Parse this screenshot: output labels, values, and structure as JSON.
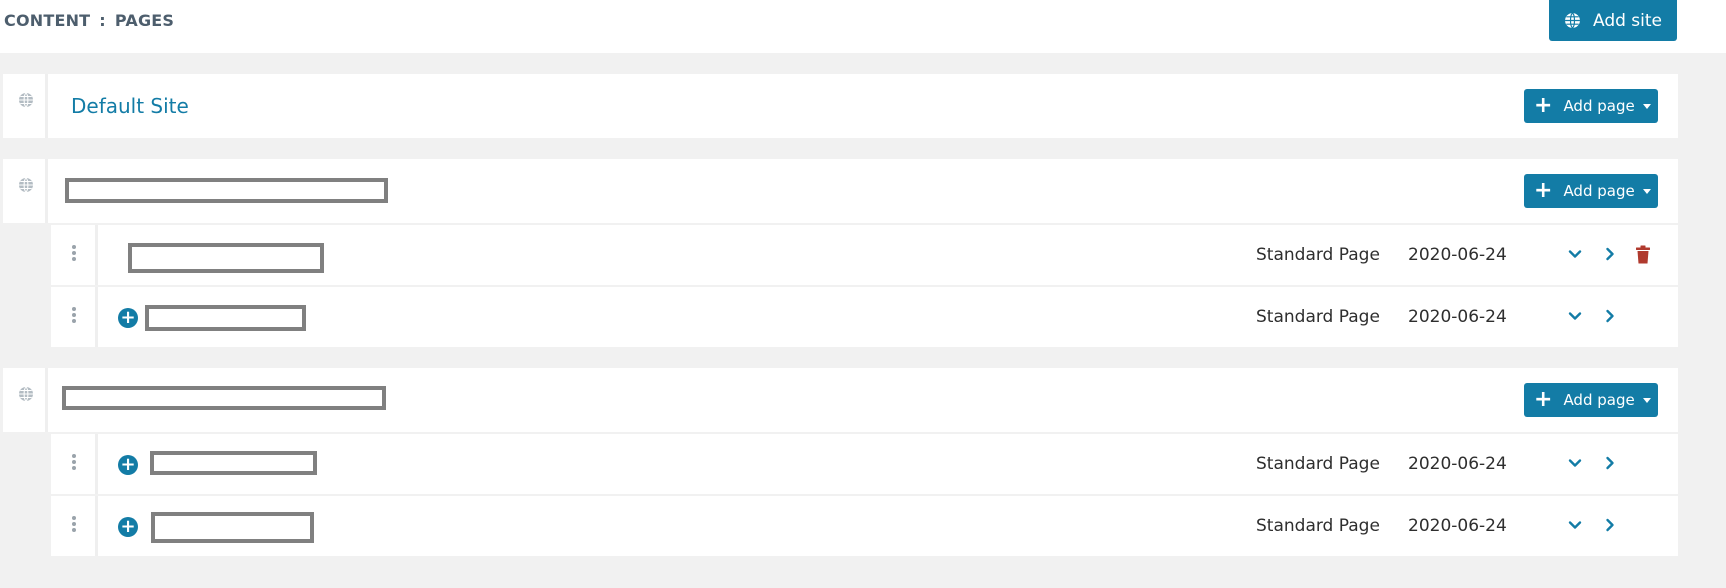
{
  "breadcrumb": {
    "section": "CONTENT",
    "separator": ":",
    "page": "PAGES"
  },
  "header": {
    "add_site_label": "Add site",
    "add_site_icon": "globe-icon"
  },
  "colors": {
    "accent": "#137ca6",
    "danger": "#b03a2e",
    "redaction": "#808080"
  },
  "sites": [
    {
      "name": "Default Site",
      "add_page_label": "Add page",
      "icon": "globe-icon"
    },
    {
      "name": "",
      "add_page_label": "Add page",
      "icon": "globe-icon"
    },
    {
      "name": "",
      "add_page_label": "Add page",
      "icon": "globe-icon"
    }
  ],
  "pages": [
    {
      "title": "",
      "type": "Standard Page",
      "date": "2020-06-24",
      "has_children": false,
      "deletable": true
    },
    {
      "title": "",
      "type": "Standard Page",
      "date": "2020-06-24",
      "has_children": true,
      "deletable": false
    },
    {
      "title": "",
      "type": "Standard Page",
      "date": "2020-06-24",
      "has_children": true,
      "deletable": false
    },
    {
      "title": "",
      "type": "Standard Page",
      "date": "2020-06-24",
      "has_children": true,
      "deletable": false
    }
  ]
}
